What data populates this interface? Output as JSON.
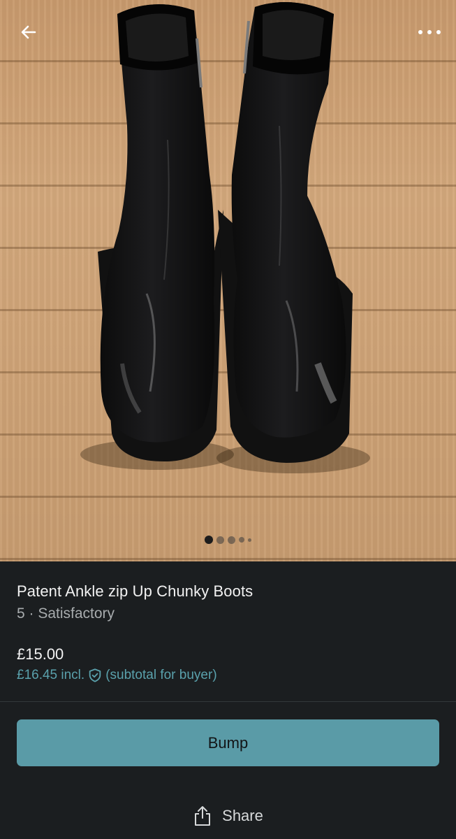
{
  "header": {
    "back_icon": "arrow-left-icon",
    "more_icon": "more-horizontal-icon"
  },
  "gallery": {
    "image_count": 5,
    "active_index": 0
  },
  "listing": {
    "title": "Patent Ankle zip Up Chunky Boots",
    "subtitle": "5 · Satisfactory",
    "price": "£15.00",
    "price_incl": "£16.45 incl.",
    "buyer_protection_icon": "shield-check-icon",
    "price_incl_note": "(subtotal for buyer)"
  },
  "actions": {
    "bump_label": "Bump",
    "share_label": "Share",
    "share_icon": "share-icon"
  },
  "colors": {
    "accent": "#5a9ba7",
    "accent_text": "#5aa1ac",
    "background": "#1b1e20"
  }
}
